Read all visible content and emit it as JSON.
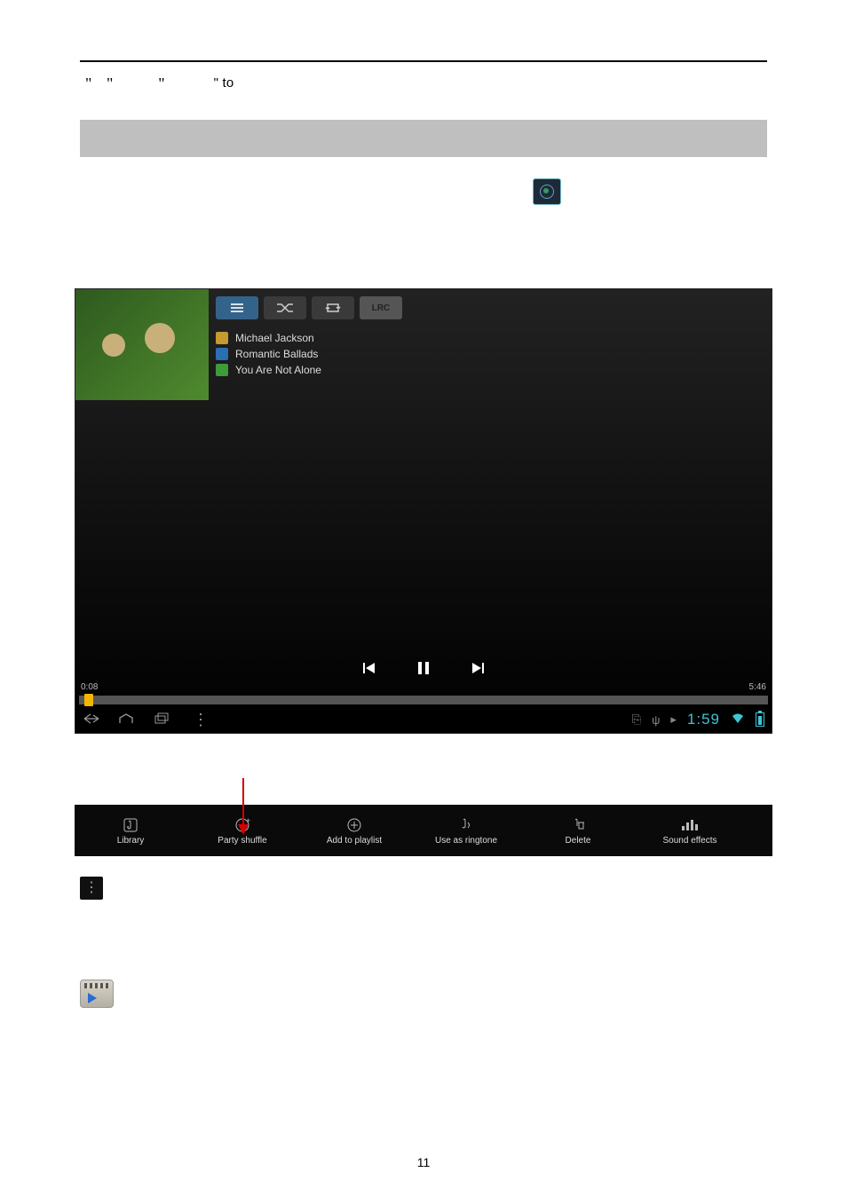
{
  "line1": {
    "pre": "",
    "quote1_open": "\"",
    "quote1_close": "\"",
    "gap1": "",
    "quote2_open": "\"",
    "quote2_close": "\" to",
    "rest": ""
  },
  "player": {
    "artist": "Michael Jackson",
    "album": "Romantic Ballads",
    "song": "You Are Not Alone",
    "lrc": "LRC",
    "time_elapsed": "0:08",
    "time_total": "5:46",
    "clock": "1:59"
  },
  "menu": {
    "library": "Library",
    "party": "Party shuffle",
    "add": "Add to playlist",
    "ringtone": "Use as ringtone",
    "delete": "Delete",
    "sound": "Sound effects"
  },
  "page_num": "11"
}
